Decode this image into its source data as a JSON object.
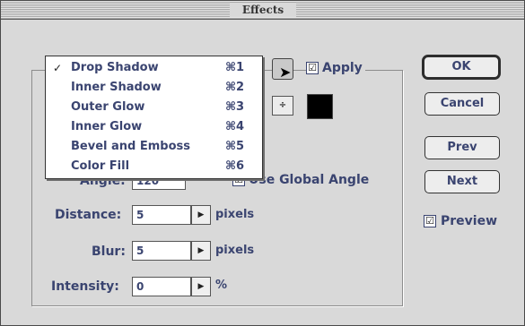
{
  "window": {
    "title": "Effects"
  },
  "effect_menu": {
    "selected": "Drop Shadow",
    "items": [
      {
        "label": "Drop Shadow",
        "shortcut": "⌘1",
        "checked": "✓"
      },
      {
        "label": "Inner Shadow",
        "shortcut": "⌘2",
        "checked": ""
      },
      {
        "label": "Outer Glow",
        "shortcut": "⌘3",
        "checked": ""
      },
      {
        "label": "Inner Glow",
        "shortcut": "⌘4",
        "checked": ""
      },
      {
        "label": "Bevel and Emboss",
        "shortcut": "⌘5",
        "checked": ""
      },
      {
        "label": "Color Fill",
        "shortcut": "⌘6",
        "checked": ""
      }
    ]
  },
  "apply": {
    "label": "Apply",
    "checked": "☑"
  },
  "mode_stepper": {
    "glyph": "÷"
  },
  "shadow_color": "#000000",
  "angle": {
    "label": "Angle:",
    "value": "120",
    "global_label": "Use Global Angle"
  },
  "distance": {
    "label": "Distance:",
    "value": "5",
    "unit": "pixels"
  },
  "blur": {
    "label": "Blur:",
    "value": "5",
    "unit": "pixels"
  },
  "intensity": {
    "label": "Intensity:",
    "value": "0",
    "unit": "%"
  },
  "buttons": {
    "ok": "OK",
    "cancel": "Cancel",
    "prev": "Prev",
    "next": "Next"
  },
  "preview": {
    "label": "Preview",
    "checked": "☑"
  },
  "arrow_glyph": "▶"
}
